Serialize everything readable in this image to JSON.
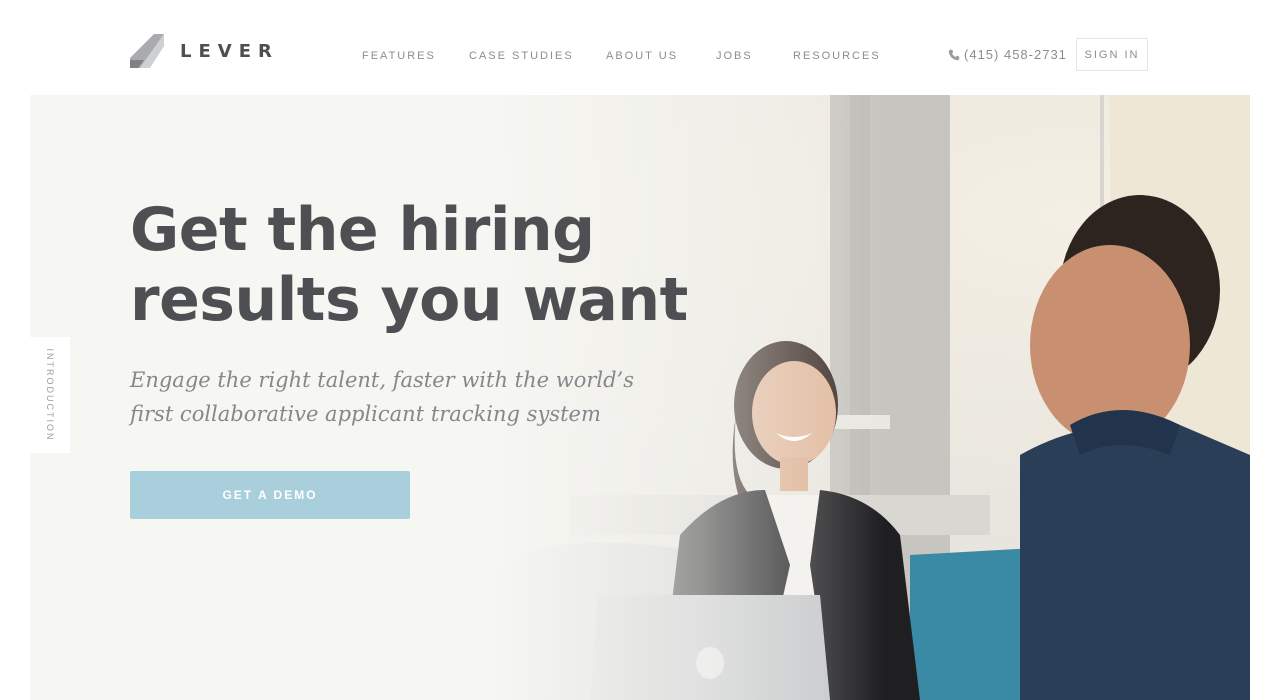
{
  "header": {
    "logo_text": "LEVER",
    "nav": [
      {
        "label": "FEATURES"
      },
      {
        "label": "CASE STUDIES"
      },
      {
        "label": "ABOUT US"
      },
      {
        "label": "JOBS"
      },
      {
        "label": "RESOURCES"
      }
    ],
    "phone": "(415) 458-2731",
    "phone_icon": "phone-icon",
    "sign_in": "SIGN IN"
  },
  "hero": {
    "headline_line1": "Get the hiring",
    "headline_line2": "results you want",
    "subhead_line1": "Engage the right talent, faster with the world’s",
    "subhead_line2": "first collaborative applicant tracking system",
    "cta": "GET A DEMO",
    "side_tab": "INTRODUCTION"
  },
  "colors": {
    "text_dark": "#4d4f53",
    "text_muted": "#8a8c90",
    "cta_bg": "#a9cfdc",
    "hero_bg": "#f6f6f2",
    "jacket_blue": "#2b3e57",
    "couch_teal": "#3a8aa6"
  }
}
